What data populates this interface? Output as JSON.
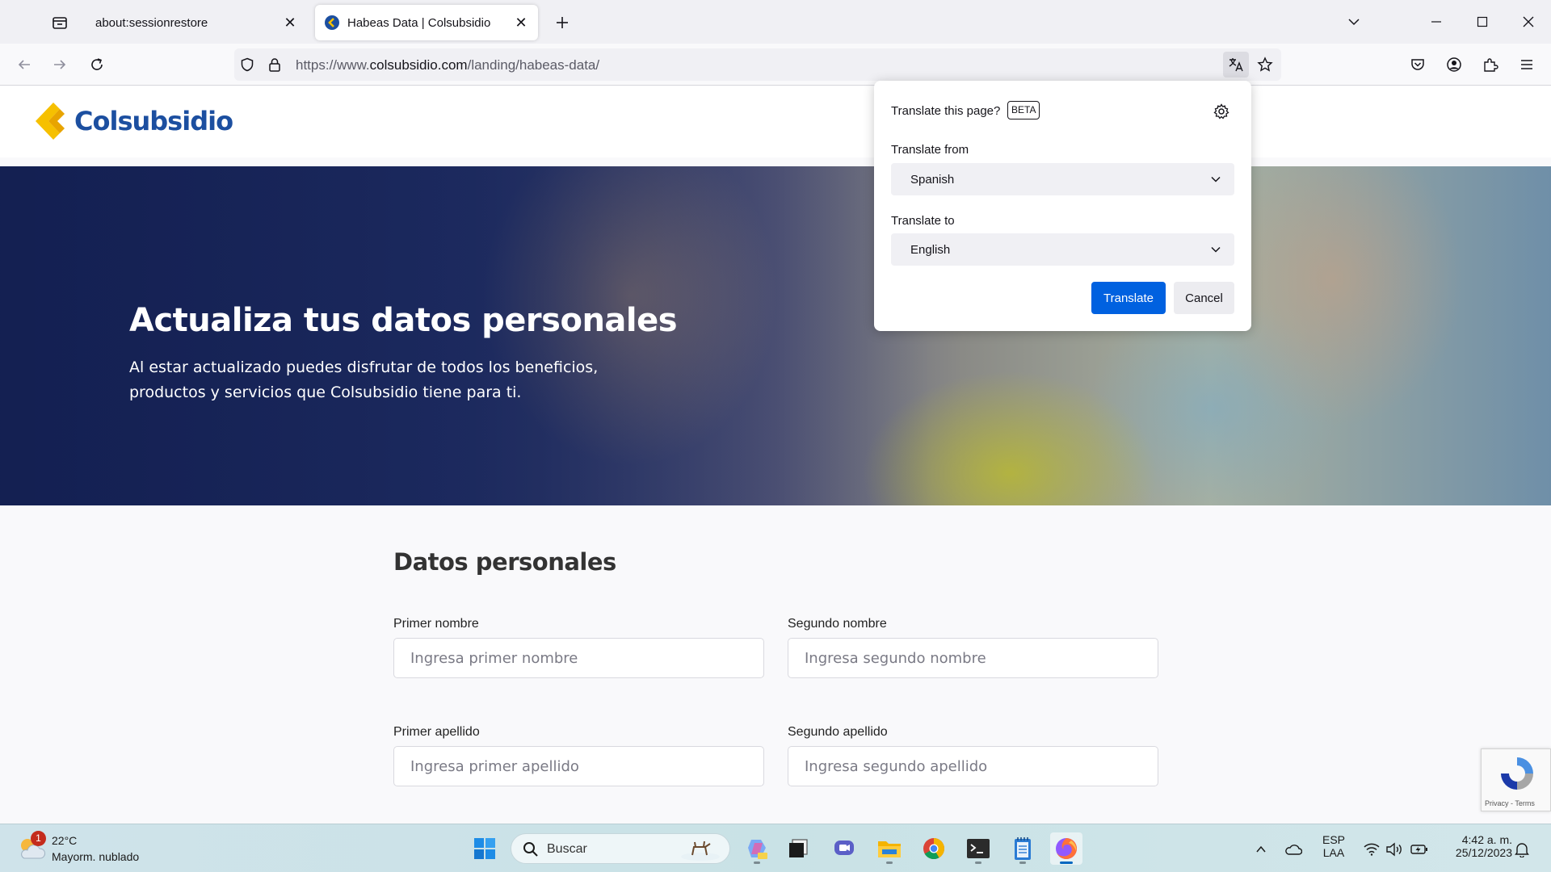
{
  "browser": {
    "tabs": [
      {
        "title": "about:sessionrestore",
        "active": false
      },
      {
        "title": "Habeas Data | Colsubsidio",
        "active": true
      }
    ],
    "url": {
      "scheme": "https://www.",
      "host": "colsubsidio.com",
      "path": "/landing/habeas-data/"
    }
  },
  "site": {
    "logo_text": "Colsubsidio",
    "brand_colors": {
      "blue": "#1c4fa0",
      "yellow": "#f6c000"
    }
  },
  "hero": {
    "title": "Actualiza tus datos personales",
    "subtitle": "Al estar actualizado puedes disfrutar de todos los beneficios, productos y servicios que Colsubsidio tiene para ti."
  },
  "form": {
    "title": "Datos personales",
    "fields": [
      {
        "label": "Primer nombre",
        "placeholder": "Ingresa primer nombre"
      },
      {
        "label": "Segundo nombre",
        "placeholder": "Ingresa segundo nombre"
      },
      {
        "label": "Primer apellido",
        "placeholder": "Ingresa primer apellido"
      },
      {
        "label": "Segundo apellido",
        "placeholder": "Ingresa segundo apellido"
      }
    ]
  },
  "recaptcha": {
    "terms": "Privacy - Terms"
  },
  "translate_popup": {
    "title": "Translate this page?",
    "badge": "BETA",
    "from_label": "Translate from",
    "from_value": "Spanish",
    "to_label": "Translate to",
    "to_value": "English",
    "translate_button": "Translate",
    "cancel_button": "Cancel",
    "accent_color": "#0061e0"
  },
  "taskbar": {
    "weather": {
      "temp": "22°C",
      "desc": "Mayorm. nublado",
      "badge": "1"
    },
    "search_placeholder": "Buscar",
    "language": {
      "line1": "ESP",
      "line2": "LAA"
    },
    "clock": {
      "time": "4:42 a. m.",
      "date": "25/12/2023"
    }
  }
}
